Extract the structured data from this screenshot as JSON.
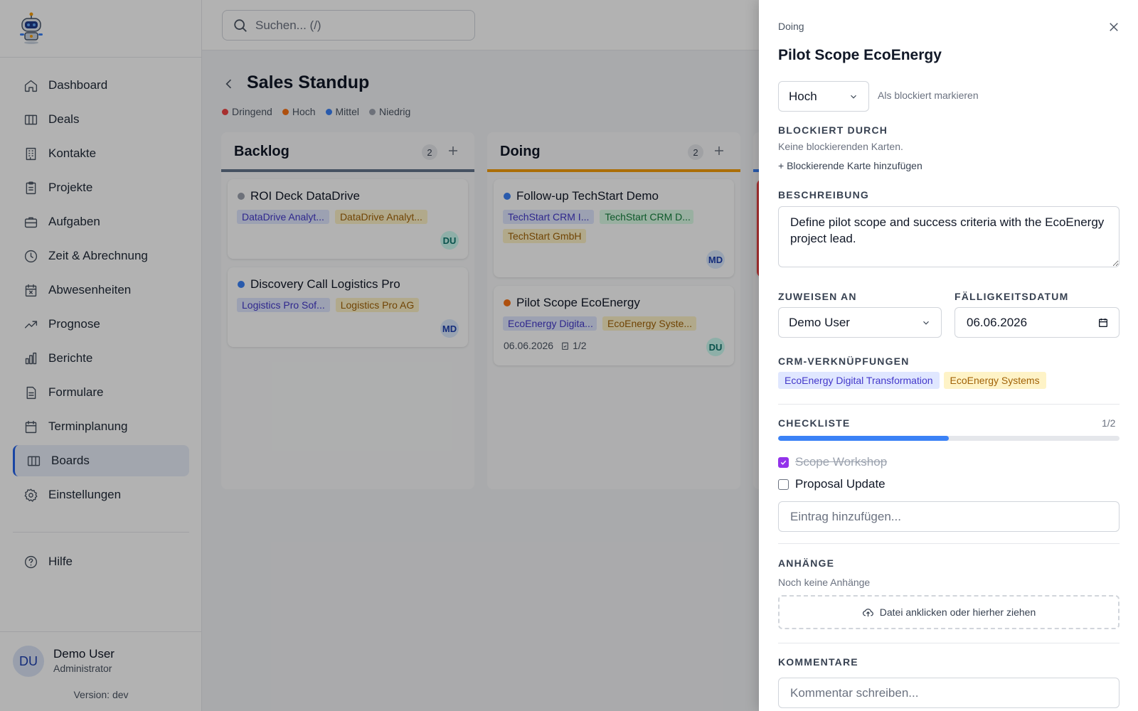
{
  "sidebar": {
    "items": [
      {
        "label": "Dashboard"
      },
      {
        "label": "Deals"
      },
      {
        "label": "Kontakte"
      },
      {
        "label": "Projekte"
      },
      {
        "label": "Aufgaben"
      },
      {
        "label": "Zeit & Abrechnung"
      },
      {
        "label": "Abwesenheiten"
      },
      {
        "label": "Prognose"
      },
      {
        "label": "Berichte"
      },
      {
        "label": "Formulare"
      },
      {
        "label": "Terminplanung"
      },
      {
        "label": "Boards"
      },
      {
        "label": "Einstellungen"
      }
    ],
    "help": "Hilfe",
    "user": {
      "initials": "DU",
      "name": "Demo User",
      "role": "Administrator"
    },
    "version": "Version: dev"
  },
  "search": {
    "placeholder": "Suchen... (/)"
  },
  "board": {
    "title": "Sales Standup",
    "legend": [
      {
        "label": "Dringend",
        "color": "#ef4444"
      },
      {
        "label": "Hoch",
        "color": "#f97316"
      },
      {
        "label": "Mittel",
        "color": "#3b82f6"
      },
      {
        "label": "Niedrig",
        "color": "#9ca3af"
      }
    ],
    "columns": [
      {
        "title": "Backlog",
        "count": "2",
        "color": "#64748b",
        "cards": [
          {
            "title": "ROI Deck DataDrive",
            "tags": [
              "DataDrive Analyt...",
              "DataDrive Analyt..."
            ],
            "avatar": "DU"
          },
          {
            "title": "Discovery Call Logistics Pro",
            "tags": [
              "Logistics Pro Sof...",
              "Logistics Pro AG"
            ],
            "avatar": "MD"
          }
        ]
      },
      {
        "title": "Doing",
        "count": "2",
        "color": "#f59e0b",
        "cards": [
          {
            "title": "Follow-up TechStart Demo",
            "tags": [
              "TechStart CRM I...",
              "TechStart CRM D...",
              "TechStart GmbH"
            ],
            "avatar": "MD"
          },
          {
            "title": "Pilot Scope EcoEnergy",
            "tags": [
              "EcoEnergy Digita...",
              "EcoEnergy Syste..."
            ],
            "due": "06.06.2026",
            "checklist": "1/2",
            "avatar": "DU"
          }
        ]
      }
    ]
  },
  "panel": {
    "column": "Doing",
    "title": "Pilot Scope EcoEnergy",
    "priority": "Hoch",
    "mark_blocked": "Als blockiert markieren",
    "blocked_by": {
      "label": "BLOCKIERT DURCH",
      "empty": "Keine blockierenden Karten.",
      "add": "+ Blockierende Karte hinzufügen"
    },
    "description": {
      "label": "BESCHREIBUNG",
      "value": "Define pilot scope and success criteria with the EcoEnergy project lead."
    },
    "assign": {
      "label": "ZUWEISEN AN",
      "value": "Demo User"
    },
    "due": {
      "label": "FÄLLIGKEITSDATUM",
      "value": "06.06.2026"
    },
    "crm": {
      "label": "CRM-VERKNÜPFUNGEN",
      "links": [
        "EcoEnergy Digital Transformation",
        "EcoEnergy Systems"
      ]
    },
    "checklist": {
      "label": "CHECKLISTE",
      "count": "1/2",
      "progress": 0.5,
      "items": [
        {
          "text": "Scope Workshop",
          "done": true
        },
        {
          "text": "Proposal Update",
          "done": false
        }
      ],
      "placeholder": "Eintrag hinzufügen..."
    },
    "attachments": {
      "label": "ANHÄNGE",
      "empty": "Noch keine Anhänge",
      "dropzone": "Datei anklicken oder hierher ziehen"
    },
    "comments": {
      "label": "KOMMENTARE",
      "placeholder": "Kommentar schreiben..."
    }
  }
}
